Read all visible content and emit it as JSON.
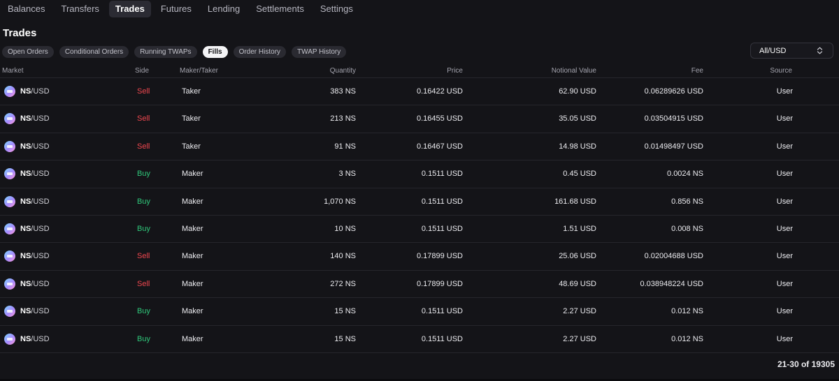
{
  "nav": [
    "Balances",
    "Transfers",
    "Trades",
    "Futures",
    "Lending",
    "Settlements",
    "Settings"
  ],
  "nav_active": 2,
  "page_title": "Trades",
  "subtabs": [
    "Open Orders",
    "Conditional Orders",
    "Running TWAPs",
    "Fills",
    "Order History",
    "TWAP History"
  ],
  "subtab_active": 3,
  "market_select": {
    "value": "All/USD"
  },
  "table": {
    "headers": {
      "market": "Market",
      "side": "Side",
      "maker_taker": "Maker/Taker",
      "quantity": "Quantity",
      "price": "Price",
      "notional": "Notional Value",
      "fee": "Fee",
      "source": "Source"
    },
    "rows": [
      {
        "base": "NS",
        "quote": "/USD",
        "side": "Sell",
        "role": "Taker",
        "quantity": "383 NS",
        "price": "0.16422 USD",
        "notional": "62.90 USD",
        "fee": "0.06289626 USD",
        "source": "User"
      },
      {
        "base": "NS",
        "quote": "/USD",
        "side": "Sell",
        "role": "Taker",
        "quantity": "213 NS",
        "price": "0.16455 USD",
        "notional": "35.05 USD",
        "fee": "0.03504915 USD",
        "source": "User"
      },
      {
        "base": "NS",
        "quote": "/USD",
        "side": "Sell",
        "role": "Taker",
        "quantity": "91 NS",
        "price": "0.16467 USD",
        "notional": "14.98 USD",
        "fee": "0.01498497 USD",
        "source": "User"
      },
      {
        "base": "NS",
        "quote": "/USD",
        "side": "Buy",
        "role": "Maker",
        "quantity": "3 NS",
        "price": "0.1511 USD",
        "notional": "0.45 USD",
        "fee": "0.0024 NS",
        "source": "User"
      },
      {
        "base": "NS",
        "quote": "/USD",
        "side": "Buy",
        "role": "Maker",
        "quantity": "1,070 NS",
        "price": "0.1511 USD",
        "notional": "161.68 USD",
        "fee": "0.856 NS",
        "source": "User"
      },
      {
        "base": "NS",
        "quote": "/USD",
        "side": "Buy",
        "role": "Maker",
        "quantity": "10 NS",
        "price": "0.1511 USD",
        "notional": "1.51 USD",
        "fee": "0.008 NS",
        "source": "User"
      },
      {
        "base": "NS",
        "quote": "/USD",
        "side": "Sell",
        "role": "Maker",
        "quantity": "140 NS",
        "price": "0.17899 USD",
        "notional": "25.06 USD",
        "fee": "0.02004688 USD",
        "source": "User"
      },
      {
        "base": "NS",
        "quote": "/USD",
        "side": "Sell",
        "role": "Maker",
        "quantity": "272 NS",
        "price": "0.17899 USD",
        "notional": "48.69 USD",
        "fee": "0.038948224 USD",
        "source": "User"
      },
      {
        "base": "NS",
        "quote": "/USD",
        "side": "Buy",
        "role": "Maker",
        "quantity": "15 NS",
        "price": "0.1511 USD",
        "notional": "2.27 USD",
        "fee": "0.012 NS",
        "source": "User"
      },
      {
        "base": "NS",
        "quote": "/USD",
        "side": "Buy",
        "role": "Maker",
        "quantity": "15 NS",
        "price": "0.1511 USD",
        "notional": "2.27 USD",
        "fee": "0.012 NS",
        "source": "User"
      }
    ]
  },
  "pagination": "21-30 of 19305",
  "colors": {
    "sell": "#f0474f",
    "buy": "#2fc77a",
    "active_tab_bg": "#f4f4f6"
  }
}
